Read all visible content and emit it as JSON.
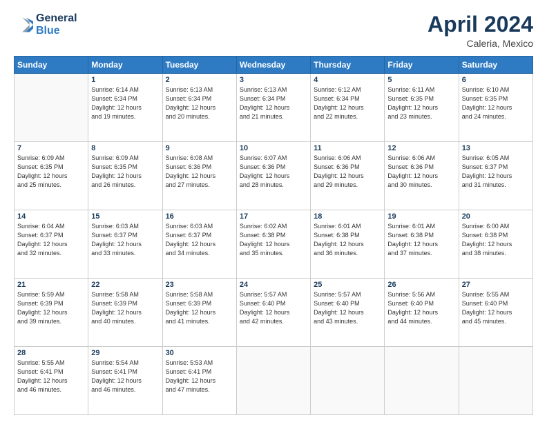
{
  "header": {
    "logo_line1": "General",
    "logo_line2": "Blue",
    "month_title": "April 2024",
    "location": "Caleria, Mexico"
  },
  "weekdays": [
    "Sunday",
    "Monday",
    "Tuesday",
    "Wednesday",
    "Thursday",
    "Friday",
    "Saturday"
  ],
  "weeks": [
    [
      {
        "day": "",
        "sunrise": "",
        "sunset": "",
        "daylight": ""
      },
      {
        "day": "1",
        "sunrise": "Sunrise: 6:14 AM",
        "sunset": "Sunset: 6:34 PM",
        "daylight": "Daylight: 12 hours and 19 minutes."
      },
      {
        "day": "2",
        "sunrise": "Sunrise: 6:13 AM",
        "sunset": "Sunset: 6:34 PM",
        "daylight": "Daylight: 12 hours and 20 minutes."
      },
      {
        "day": "3",
        "sunrise": "Sunrise: 6:13 AM",
        "sunset": "Sunset: 6:34 PM",
        "daylight": "Daylight: 12 hours and 21 minutes."
      },
      {
        "day": "4",
        "sunrise": "Sunrise: 6:12 AM",
        "sunset": "Sunset: 6:34 PM",
        "daylight": "Daylight: 12 hours and 22 minutes."
      },
      {
        "day": "5",
        "sunrise": "Sunrise: 6:11 AM",
        "sunset": "Sunset: 6:35 PM",
        "daylight": "Daylight: 12 hours and 23 minutes."
      },
      {
        "day": "6",
        "sunrise": "Sunrise: 6:10 AM",
        "sunset": "Sunset: 6:35 PM",
        "daylight": "Daylight: 12 hours and 24 minutes."
      }
    ],
    [
      {
        "day": "7",
        "sunrise": "Sunrise: 6:09 AM",
        "sunset": "Sunset: 6:35 PM",
        "daylight": "Daylight: 12 hours and 25 minutes."
      },
      {
        "day": "8",
        "sunrise": "Sunrise: 6:09 AM",
        "sunset": "Sunset: 6:35 PM",
        "daylight": "Daylight: 12 hours and 26 minutes."
      },
      {
        "day": "9",
        "sunrise": "Sunrise: 6:08 AM",
        "sunset": "Sunset: 6:36 PM",
        "daylight": "Daylight: 12 hours and 27 minutes."
      },
      {
        "day": "10",
        "sunrise": "Sunrise: 6:07 AM",
        "sunset": "Sunset: 6:36 PM",
        "daylight": "Daylight: 12 hours and 28 minutes."
      },
      {
        "day": "11",
        "sunrise": "Sunrise: 6:06 AM",
        "sunset": "Sunset: 6:36 PM",
        "daylight": "Daylight: 12 hours and 29 minutes."
      },
      {
        "day": "12",
        "sunrise": "Sunrise: 6:06 AM",
        "sunset": "Sunset: 6:36 PM",
        "daylight": "Daylight: 12 hours and 30 minutes."
      },
      {
        "day": "13",
        "sunrise": "Sunrise: 6:05 AM",
        "sunset": "Sunset: 6:37 PM",
        "daylight": "Daylight: 12 hours and 31 minutes."
      }
    ],
    [
      {
        "day": "14",
        "sunrise": "Sunrise: 6:04 AM",
        "sunset": "Sunset: 6:37 PM",
        "daylight": "Daylight: 12 hours and 32 minutes."
      },
      {
        "day": "15",
        "sunrise": "Sunrise: 6:03 AM",
        "sunset": "Sunset: 6:37 PM",
        "daylight": "Daylight: 12 hours and 33 minutes."
      },
      {
        "day": "16",
        "sunrise": "Sunrise: 6:03 AM",
        "sunset": "Sunset: 6:37 PM",
        "daylight": "Daylight: 12 hours and 34 minutes."
      },
      {
        "day": "17",
        "sunrise": "Sunrise: 6:02 AM",
        "sunset": "Sunset: 6:38 PM",
        "daylight": "Daylight: 12 hours and 35 minutes."
      },
      {
        "day": "18",
        "sunrise": "Sunrise: 6:01 AM",
        "sunset": "Sunset: 6:38 PM",
        "daylight": "Daylight: 12 hours and 36 minutes."
      },
      {
        "day": "19",
        "sunrise": "Sunrise: 6:01 AM",
        "sunset": "Sunset: 6:38 PM",
        "daylight": "Daylight: 12 hours and 37 minutes."
      },
      {
        "day": "20",
        "sunrise": "Sunrise: 6:00 AM",
        "sunset": "Sunset: 6:38 PM",
        "daylight": "Daylight: 12 hours and 38 minutes."
      }
    ],
    [
      {
        "day": "21",
        "sunrise": "Sunrise: 5:59 AM",
        "sunset": "Sunset: 6:39 PM",
        "daylight": "Daylight: 12 hours and 39 minutes."
      },
      {
        "day": "22",
        "sunrise": "Sunrise: 5:58 AM",
        "sunset": "Sunset: 6:39 PM",
        "daylight": "Daylight: 12 hours and 40 minutes."
      },
      {
        "day": "23",
        "sunrise": "Sunrise: 5:58 AM",
        "sunset": "Sunset: 6:39 PM",
        "daylight": "Daylight: 12 hours and 41 minutes."
      },
      {
        "day": "24",
        "sunrise": "Sunrise: 5:57 AM",
        "sunset": "Sunset: 6:40 PM",
        "daylight": "Daylight: 12 hours and 42 minutes."
      },
      {
        "day": "25",
        "sunrise": "Sunrise: 5:57 AM",
        "sunset": "Sunset: 6:40 PM",
        "daylight": "Daylight: 12 hours and 43 minutes."
      },
      {
        "day": "26",
        "sunrise": "Sunrise: 5:56 AM",
        "sunset": "Sunset: 6:40 PM",
        "daylight": "Daylight: 12 hours and 44 minutes."
      },
      {
        "day": "27",
        "sunrise": "Sunrise: 5:55 AM",
        "sunset": "Sunset: 6:40 PM",
        "daylight": "Daylight: 12 hours and 45 minutes."
      }
    ],
    [
      {
        "day": "28",
        "sunrise": "Sunrise: 5:55 AM",
        "sunset": "Sunset: 6:41 PM",
        "daylight": "Daylight: 12 hours and 46 minutes."
      },
      {
        "day": "29",
        "sunrise": "Sunrise: 5:54 AM",
        "sunset": "Sunset: 6:41 PM",
        "daylight": "Daylight: 12 hours and 46 minutes."
      },
      {
        "day": "30",
        "sunrise": "Sunrise: 5:53 AM",
        "sunset": "Sunset: 6:41 PM",
        "daylight": "Daylight: 12 hours and 47 minutes."
      },
      {
        "day": "",
        "sunrise": "",
        "sunset": "",
        "daylight": ""
      },
      {
        "day": "",
        "sunrise": "",
        "sunset": "",
        "daylight": ""
      },
      {
        "day": "",
        "sunrise": "",
        "sunset": "",
        "daylight": ""
      },
      {
        "day": "",
        "sunrise": "",
        "sunset": "",
        "daylight": ""
      }
    ]
  ]
}
